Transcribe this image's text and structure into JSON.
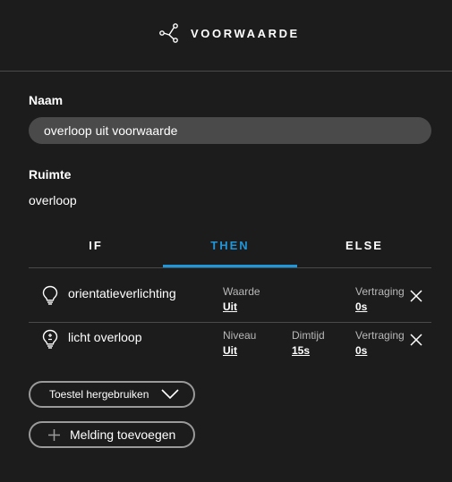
{
  "header": {
    "title": "VOORWAARDE",
    "icon": "share-nodes-icon"
  },
  "form": {
    "name_label": "Naam",
    "name_value": "overloop uit voorwaarde",
    "room_label": "Ruimte",
    "room_value": "overloop"
  },
  "tabs": [
    {
      "label": "IF",
      "active": false
    },
    {
      "label": "THEN",
      "active": true
    },
    {
      "label": "ELSE",
      "active": false
    }
  ],
  "actions": [
    {
      "name": "orientatieverlichting",
      "icon": "lightbulb-icon",
      "fields": [
        {
          "label": "Waarde",
          "value": "Uit"
        },
        {
          "label": "Vertraging",
          "value": "0s"
        }
      ]
    },
    {
      "name": "licht overloop",
      "icon": "dimmable-lightbulb-icon",
      "fields": [
        {
          "label": "Niveau",
          "value": "Uit"
        },
        {
          "label": "Dimtijd",
          "value": "15s"
        },
        {
          "label": "Vertraging",
          "value": "0s"
        }
      ]
    }
  ],
  "buttons": {
    "reuse_device": "Toestel hergebruiken",
    "add_notification": "Melding toevoegen"
  },
  "colors": {
    "accent": "#1e96d9",
    "background": "#1c1c1c",
    "input": "#4a4a4a"
  }
}
